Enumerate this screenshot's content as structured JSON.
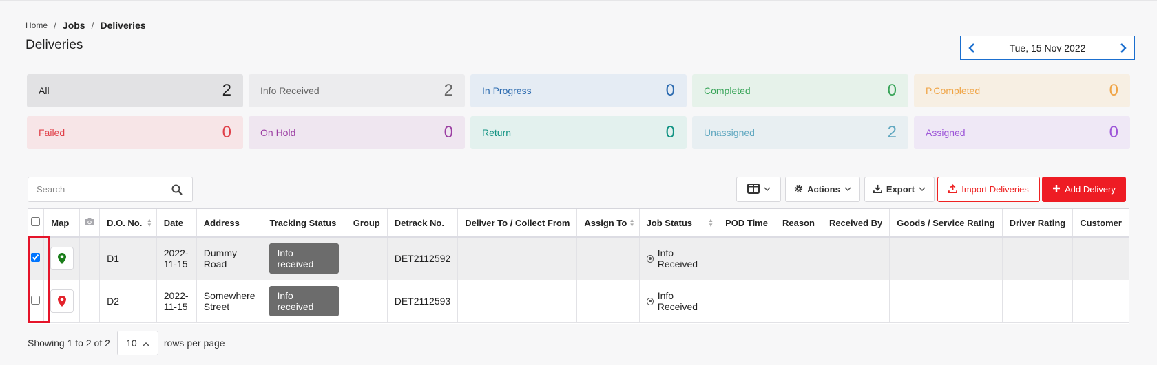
{
  "breadcrumb": {
    "home": "Home",
    "jobs": "Jobs",
    "current": "Deliveries",
    "separator": "/"
  },
  "page_title": "Deliveries",
  "date_nav": {
    "date": "Tue, 15 Nov 2022",
    "prev_icon": "chevron-left-icon",
    "next_icon": "chevron-right-icon"
  },
  "status_cards": [
    {
      "label": "All",
      "count": "2",
      "bg": "#e2e2e4",
      "color": "#222222"
    },
    {
      "label": "Info Received",
      "count": "2",
      "bg": "#ececee",
      "color": "#666666"
    },
    {
      "label": "In Progress",
      "count": "0",
      "bg": "#e5ecf4",
      "color": "#2c6bb0"
    },
    {
      "label": "Completed",
      "count": "0",
      "bg": "#e6f2ea",
      "color": "#3aa55a"
    },
    {
      "label": "P.Completed",
      "count": "0",
      "bg": "#f7efe3",
      "color": "#f0a445"
    },
    {
      "label": "Failed",
      "count": "0",
      "bg": "#f7e5e7",
      "color": "#e0414a"
    },
    {
      "label": "On Hold",
      "count": "0",
      "bg": "#efe6f0",
      "color": "#9c3fa3"
    },
    {
      "label": "Return",
      "count": "0",
      "bg": "#e3f1ee",
      "color": "#129383"
    },
    {
      "label": "Unassigned",
      "count": "2",
      "bg": "#e8eff2",
      "color": "#61a8c0"
    },
    {
      "label": "Assigned",
      "count": "0",
      "bg": "#efe8f6",
      "color": "#9d56d8"
    }
  ],
  "search": {
    "placeholder": "Search"
  },
  "toolbar": {
    "actions_label": "Actions",
    "export_label": "Export",
    "import_label": "Import Deliveries",
    "add_label": "Add Delivery"
  },
  "table": {
    "columns": [
      "",
      "Map",
      "",
      "D.O. No.",
      "Date",
      "Address",
      "Tracking Status",
      "Group",
      "Detrack No.",
      "Deliver To / Collect From",
      "Assign To",
      "Job Status",
      "POD Time",
      "Reason",
      "Received By",
      "Goods / Service Rating",
      "Driver Rating",
      "Customer"
    ],
    "rows": [
      {
        "selected": true,
        "pin_color": "#1a7d1a",
        "do_no": "D1",
        "date": "2022-11-15",
        "address": "Dummy Road",
        "tracking_status": "Info received",
        "group": "",
        "detrack_no": "DET2112592",
        "deliver_to": "",
        "assign_to": "",
        "job_status": "Info Received",
        "pod_time": "",
        "reason": "",
        "received_by": "",
        "goods_rating": "",
        "driver_rating": "",
        "customer": ""
      },
      {
        "selected": false,
        "pin_color": "#e3232c",
        "do_no": "D2",
        "date": "2022-11-15",
        "address": "Somewhere Street",
        "tracking_status": "Info received",
        "group": "",
        "detrack_no": "DET2112593",
        "deliver_to": "",
        "assign_to": "",
        "job_status": "Info Received",
        "pod_time": "",
        "reason": "",
        "received_by": "",
        "goods_rating": "",
        "driver_rating": "",
        "customer": ""
      }
    ]
  },
  "footer": {
    "showing": "Showing 1 to 2 of 2",
    "rows_per_page_value": "10",
    "rows_per_page_label": "rows per page"
  }
}
